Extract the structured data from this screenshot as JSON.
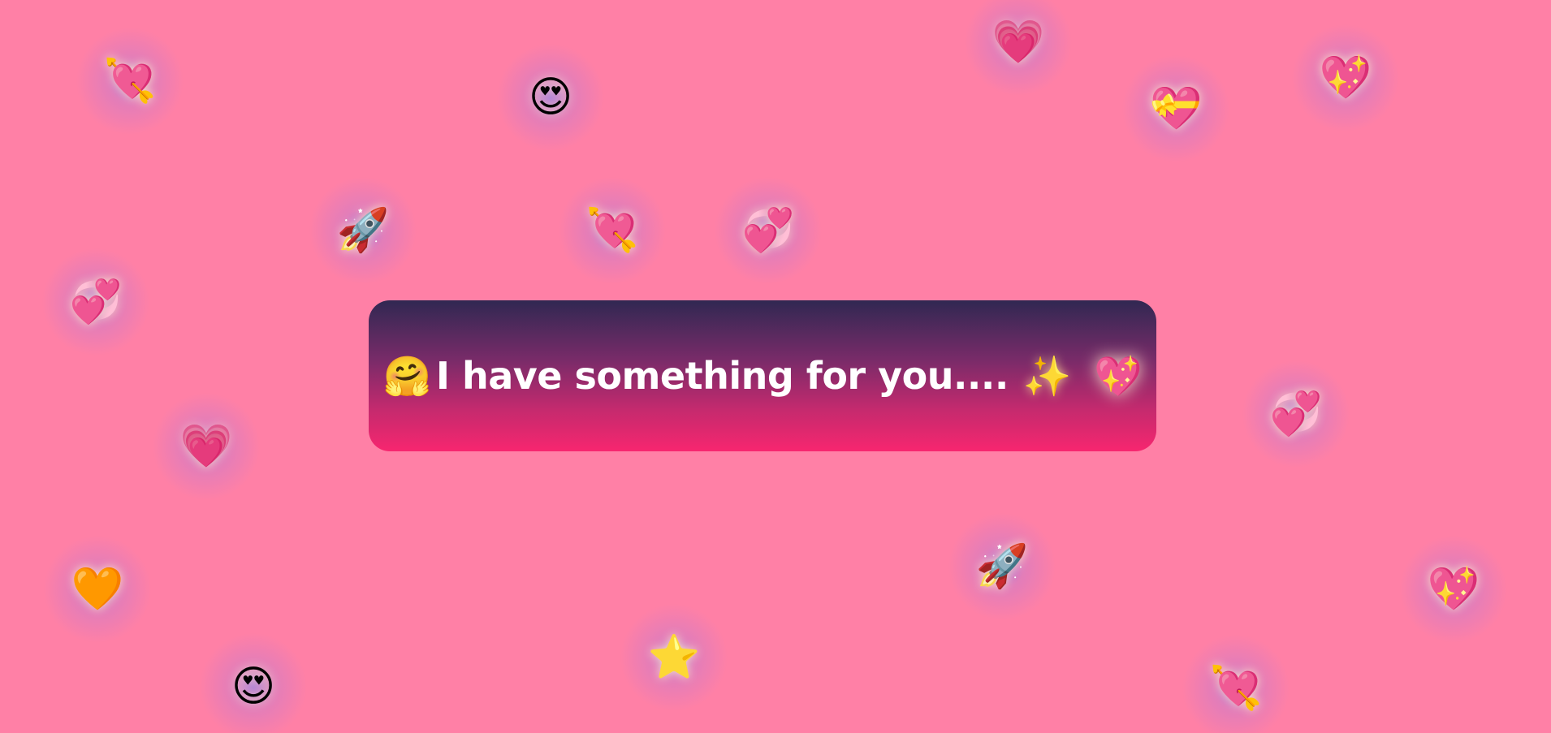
{
  "background_color": "#ff80a6",
  "card": {
    "lead_emoji": "🤗",
    "message": "I have something for you....",
    "sparkle_emoji": "✨",
    "heart_emoji": "💖",
    "gradient_top": "#302852",
    "gradient_bottom": "#f7266f"
  },
  "floaters": [
    {
      "name": "heart-with-arrow-icon",
      "emoji": "💘"
    },
    {
      "name": "heart-eyes-face-icon",
      "emoji": "😍"
    },
    {
      "name": "growing-heart-icon",
      "emoji": "💗"
    },
    {
      "name": "heart-with-ribbon-icon",
      "emoji": "💝"
    },
    {
      "name": "sparkling-heart-icon",
      "emoji": "💖"
    },
    {
      "name": "rocket-icon",
      "emoji": "🚀"
    },
    {
      "name": "heart-with-arrow-icon",
      "emoji": "💘"
    },
    {
      "name": "revolving-hearts-icon",
      "emoji": "💞"
    },
    {
      "name": "revolving-hearts-icon",
      "emoji": "💞"
    },
    {
      "name": "growing-heart-icon",
      "emoji": "💗"
    },
    {
      "name": "revolving-hearts-icon",
      "emoji": "💞"
    },
    {
      "name": "orange-heart-icon",
      "emoji": "🧡"
    },
    {
      "name": "rocket-icon",
      "emoji": "🚀"
    },
    {
      "name": "sparkling-heart-icon",
      "emoji": "💖"
    },
    {
      "name": "star-icon",
      "emoji": "⭐"
    },
    {
      "name": "heart-eyes-face-icon",
      "emoji": "😍"
    },
    {
      "name": "heart-with-arrow-icon",
      "emoji": "💘"
    }
  ]
}
